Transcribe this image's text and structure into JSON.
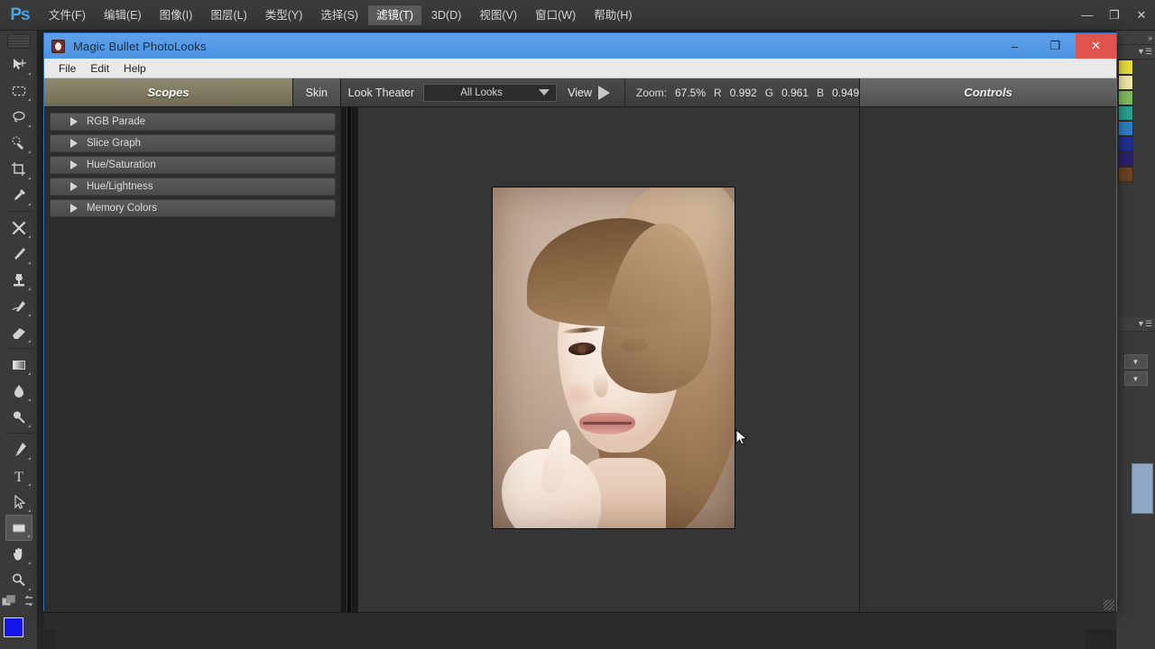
{
  "photoshop": {
    "logo": "Ps",
    "menu_items": [
      {
        "label": "文件(F)",
        "active": false
      },
      {
        "label": "编辑(E)",
        "active": false
      },
      {
        "label": "图像(I)",
        "active": false
      },
      {
        "label": "图层(L)",
        "active": false
      },
      {
        "label": "类型(Y)",
        "active": false
      },
      {
        "label": "选择(S)",
        "active": false
      },
      {
        "label": "滤镜(T)",
        "active": true
      },
      {
        "label": "3D(D)",
        "active": false
      },
      {
        "label": "视图(V)",
        "active": false
      },
      {
        "label": "窗口(W)",
        "active": false
      },
      {
        "label": "帮助(H)",
        "active": false
      }
    ],
    "window_buttons": {
      "minimize": "—",
      "maximize": "❐",
      "close": "✕"
    },
    "tools": [
      {
        "name": "move-tool",
        "icon": "move-icon"
      },
      {
        "name": "marquee-tool",
        "icon": "marquee-icon"
      },
      {
        "name": "lasso-tool",
        "icon": "lasso-icon"
      },
      {
        "name": "quick-selection-tool",
        "icon": "quick-selection-icon"
      },
      {
        "name": "crop-tool",
        "icon": "crop-icon"
      },
      {
        "name": "eyedropper-tool",
        "icon": "eyedropper-icon"
      },
      {
        "name": "healing-brush-tool",
        "icon": "healing-brush-icon"
      },
      {
        "name": "brush-tool",
        "icon": "brush-icon"
      },
      {
        "name": "clone-stamp-tool",
        "icon": "clone-stamp-icon"
      },
      {
        "name": "history-brush-tool",
        "icon": "history-brush-icon"
      },
      {
        "name": "eraser-tool",
        "icon": "eraser-icon"
      },
      {
        "name": "gradient-tool",
        "icon": "gradient-icon"
      },
      {
        "name": "blur-tool",
        "icon": "blur-drop-icon"
      },
      {
        "name": "dodge-tool",
        "icon": "dodge-icon"
      },
      {
        "name": "pen-tool",
        "icon": "pen-icon"
      },
      {
        "name": "type-tool",
        "icon": "type-icon"
      },
      {
        "name": "path-selection-tool",
        "icon": "path-arrow-icon"
      },
      {
        "name": "rectangle-shape-tool",
        "icon": "rectangle-shape-icon"
      },
      {
        "name": "hand-tool",
        "icon": "hand-icon"
      },
      {
        "name": "zoom-tool",
        "icon": "magnifier-icon"
      }
    ],
    "foreground_color": "#1414e6",
    "background_color": "#f0f0f0",
    "right_dock_swatch_colors": [
      "#e8dc3a",
      "#efe9a8",
      "#7fba5c",
      "#2a9d8f",
      "#2b7fc4",
      "#1f2f8f",
      "#2a1f6b",
      "#6b4220"
    ]
  },
  "dialog": {
    "title": "Magic Bullet PhotoLooks",
    "app_icon": "photolooks-icon",
    "title_buttons": {
      "minimize": "–",
      "maximize": "❐",
      "close": "✕"
    },
    "menu": [
      "File",
      "Edit",
      "Help"
    ],
    "tabs": {
      "scopes_label": "Scopes",
      "skin_label": "Skin",
      "controls_label": "Controls"
    },
    "toolbar": {
      "look_theater_label": "Look Theater",
      "looks_select_value": "All Looks",
      "looks_select_placeholder": "All Looks",
      "view_label": "View",
      "play_icon": "play-triangle-icon",
      "zoom_label": "Zoom:",
      "zoom_value": "67.5%",
      "r_label": "R",
      "r_value": "0.992",
      "g_label": "G",
      "g_value": "0.961",
      "b_label": "B",
      "b_value": "0.949"
    },
    "scopes_list": [
      {
        "label": "RGB Parade",
        "expanded": false
      },
      {
        "label": "Slice Graph",
        "expanded": false
      },
      {
        "label": "Hue/Saturation",
        "expanded": false
      },
      {
        "label": "Hue/Lightness",
        "expanded": false
      },
      {
        "label": "Memory Colors",
        "expanded": false
      }
    ],
    "preview": {
      "image_name": "portrait-preview-image"
    }
  },
  "colors": {
    "accent_blue": "#4d94e4",
    "scopes_tab": "#7f7a5e",
    "close_red": "#e0544f",
    "panel_bg": "#2d2d2d",
    "preview_bg": "#353535"
  }
}
